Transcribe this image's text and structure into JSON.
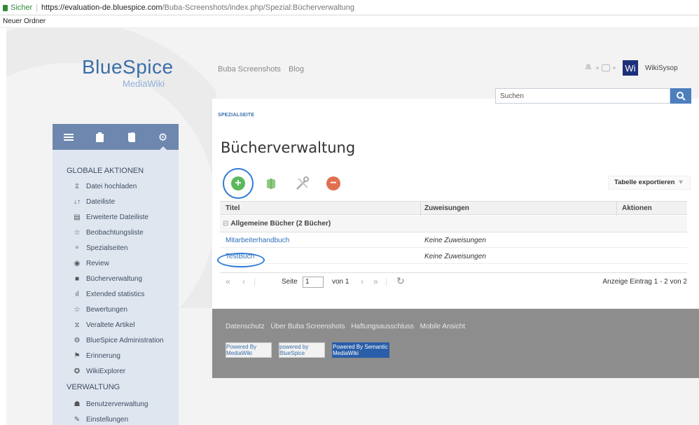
{
  "browser": {
    "secure_label": "Sicher",
    "url_host": "https://evaluation-de.bluespice.com",
    "url_path": "/Buba-Screenshots/index.php/Spezial:Bücherverwaltung",
    "bookmark": "Neuer Ordner"
  },
  "logo": {
    "main": "BlueSpice",
    "sub": "MediaWiki"
  },
  "topnav": {
    "items": [
      "Buba Screenshots",
      "Blog"
    ]
  },
  "user": {
    "avatar_initials": "Wi",
    "name": "WikiSysop"
  },
  "search": {
    "placeholder": "Suchen"
  },
  "page": {
    "label": "SPEZIALSEITE",
    "title": "Bücherverwaltung"
  },
  "sidebar": {
    "global_heading": "GLOBALE AKTIONEN",
    "global_items": [
      "Datei hochladen",
      "Dateiliste",
      "Erweiterte Dateiliste",
      "Beobachtungsliste",
      "Spezialseiten",
      "Review",
      "Bücherverwaltung",
      "Extended statistics",
      "Bewertungen",
      "Veraltete Artikel",
      "BlueSpice Administration",
      "Erinnerung",
      "WikiExplorer"
    ],
    "admin_heading": "VERWALTUNG",
    "admin_items": [
      "Benutzerverwaltung",
      "Einstellungen"
    ]
  },
  "toolbar": {
    "export_label": "Tabelle exportieren"
  },
  "grid": {
    "columns": [
      "Titel",
      "Zuweisungen",
      "Aktionen"
    ],
    "group_label": "Allgemeine Bücher (2 Bücher)",
    "rows": [
      {
        "title": "Mitarbeiterhandbuch",
        "assign": "Keine Zuweisungen"
      },
      {
        "title": "TestBuch",
        "assign": "Keine Zuweisungen"
      }
    ]
  },
  "pager": {
    "page_label": "Seite",
    "page_value": "1",
    "of_label": "von 1",
    "summary": "Anzeige Eintrag 1 - 2 von 2"
  },
  "footer": {
    "links": [
      "Datenschutz",
      "Über Buba Screenshots",
      "Haftungsausschluss",
      "Mobile Ansicht"
    ],
    "badges": [
      "Powered By MediaWiki",
      "powered by BlueSpice",
      "Powered By Semantic MediaWiki"
    ]
  },
  "colors": {
    "accent": "#4d7fbd",
    "add": "#5cb85c",
    "delete": "#e07050",
    "sidebar": "#dfe6f0",
    "tabbar": "#6d87ae",
    "annotation": "#2f7ad8"
  }
}
